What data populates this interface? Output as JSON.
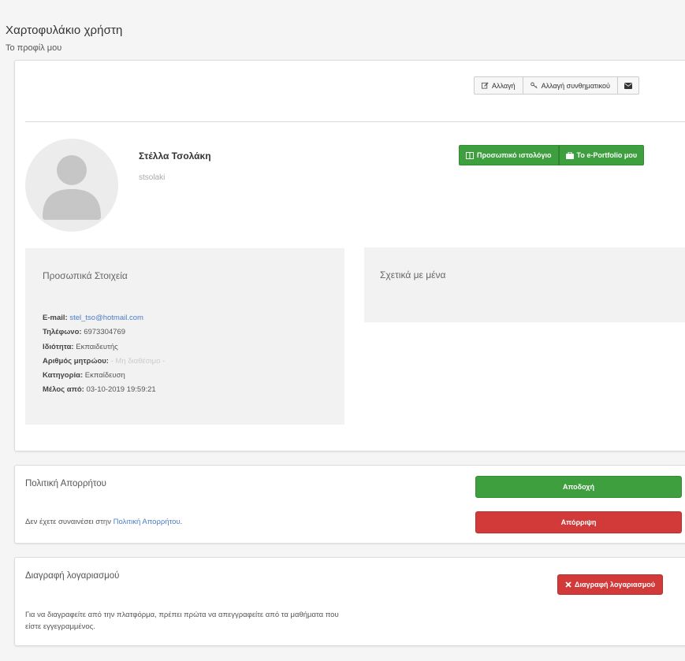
{
  "header": {
    "title": "Χαρτοφυλάκιο χρήστη",
    "subtitle": "Το προφίλ μου"
  },
  "toolbar": {
    "edit_label": "Αλλαγή",
    "change_password_label": "Αλλαγή συνθηματικού",
    "edit_icon": "edit-icon",
    "key_icon": "key-icon",
    "message_icon": "envelope-icon"
  },
  "profile": {
    "fullname": "Στέλλα Τσολάκη",
    "username": "stsolaki",
    "blog_label": "Προσωπικό ιστολόγιο",
    "eportfolio_label": "Το e-Portfolio μου"
  },
  "personal_info": {
    "title": "Προσωπικά Στοιχεία",
    "fields": [
      {
        "label": "E-mail:",
        "value": "stel_tso@hotmail.com"
      },
      {
        "label": "Τηλέφωνο:",
        "value": "6973304769"
      },
      {
        "label": "Ιδιότητα:",
        "value": "Εκπαιδευτής"
      },
      {
        "label": "Αριθμός μητρώου:",
        "value": "- Μη διαθέσιμο -"
      },
      {
        "label": "Κατηγορία:",
        "value": "Εκπαίδευση"
      },
      {
        "label": "Μέλος από:",
        "value": "03-10-2019 19:59:21"
      }
    ]
  },
  "about": {
    "title": "Σχετικά με μένα"
  },
  "privacy": {
    "title": "Πολιτική Απορρήτου",
    "text_prefix": "Δεν έχετε συναινέσει στην",
    "link_text": "Πολιτική Απορρήτου",
    "text_suffix": ".",
    "accept_label": "Αποδοχή",
    "reject_label": "Απόρριψη"
  },
  "account_delete": {
    "title": "Διαγραφή λογαριασμού",
    "button_label": "Διαγραφή λογαριασμού",
    "description_line1": "Για να διαγραφείτε από την πλατφόρμα, πρέπει πρώτα να απεγγραφείτε από τα μαθήματα που",
    "description_line2": "είστε εγγεγραμμένος."
  },
  "colors": {
    "success": "#3e9f3e",
    "danger": "#d23a3a",
    "link": "#4a7cc7"
  }
}
